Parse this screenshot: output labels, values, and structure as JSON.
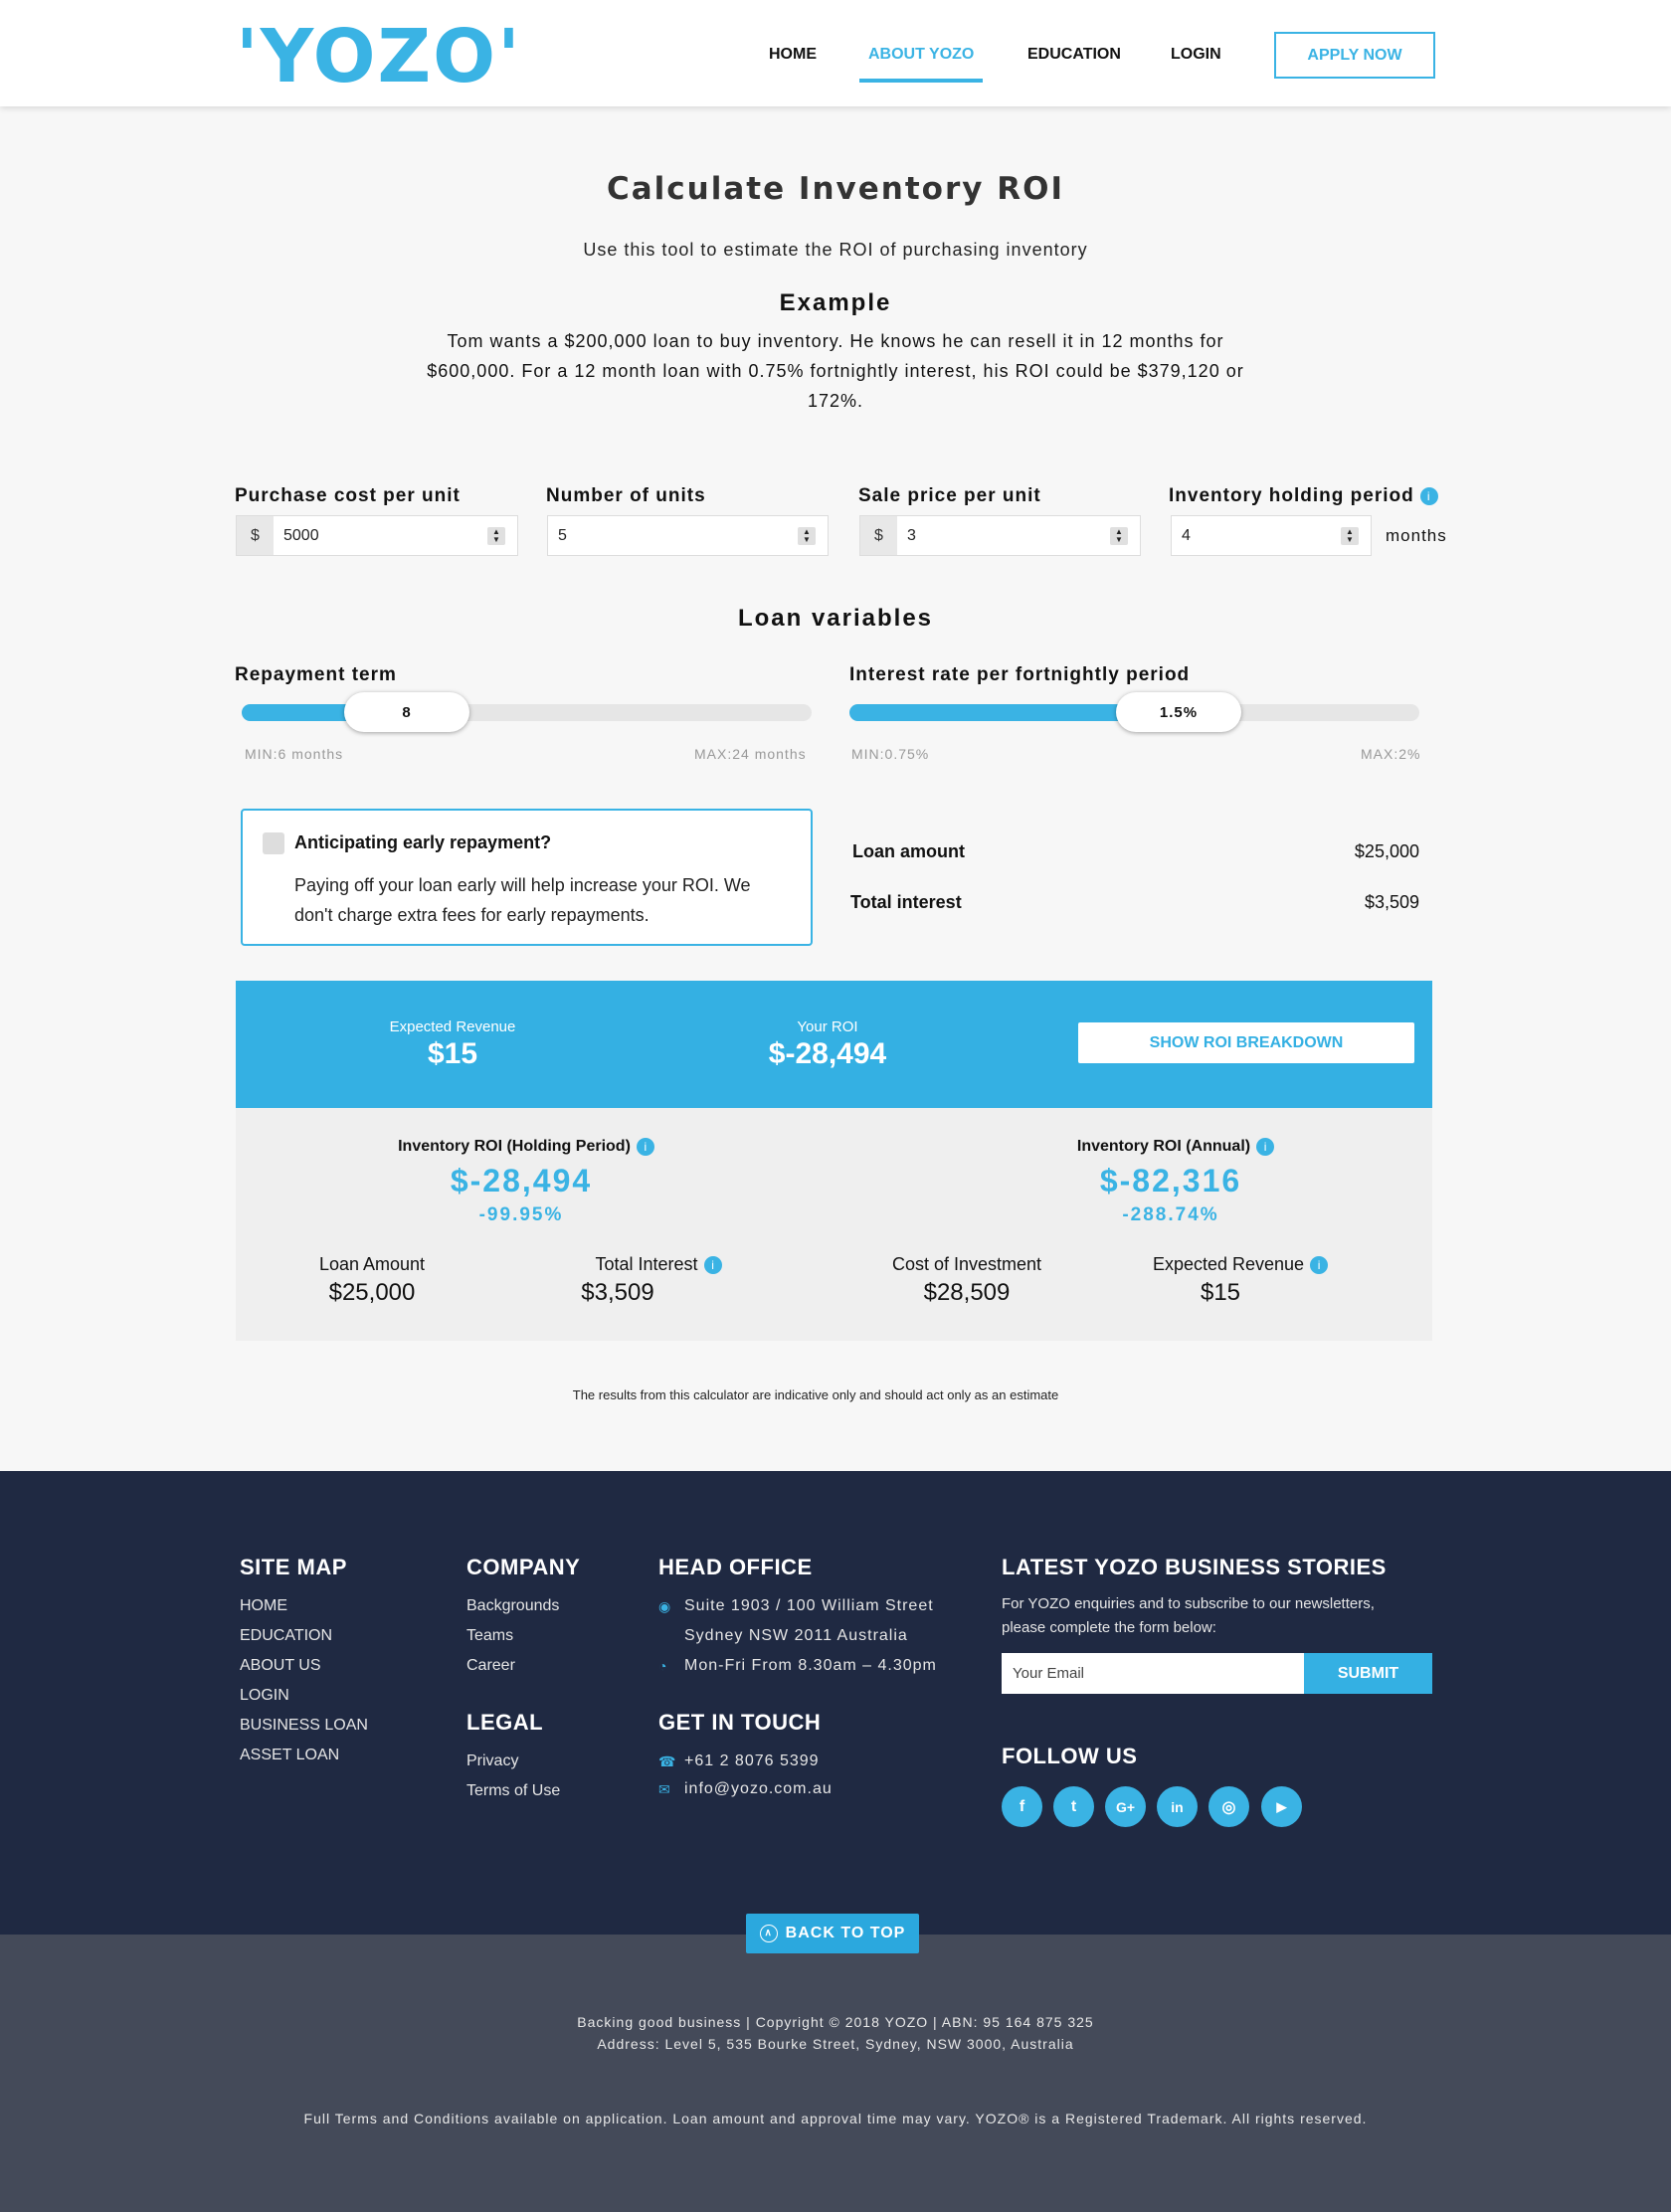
{
  "header": {
    "logo": "'YOZO'",
    "nav": [
      "HOME",
      "ABOUT YOZO",
      "EDUCATION",
      "LOGIN"
    ],
    "active_nav": "ABOUT YOZO",
    "apply": "APPLY NOW"
  },
  "intro": {
    "title": "Calculate Inventory ROI",
    "subtitle": "Use this  tool to estimate the ROI of purchasing inventory",
    "example_heading": "Example",
    "example_text": "Tom wants a $200,000 loan to buy inventory. He knows he can resell it in 12 months for $600,000. For a 12 month loan with 0.75% fortnightly interest, his ROI could be $379,120 or 172%."
  },
  "inputs": {
    "purchase_cost": {
      "label": "Purchase cost per unit",
      "prefix": "$",
      "value": "5000"
    },
    "units": {
      "label": "Number of units",
      "value": "5"
    },
    "sale_price": {
      "label": "Sale price per unit",
      "prefix": "$",
      "value": "3"
    },
    "holding": {
      "label": "Inventory holding period",
      "value": "4",
      "suffix": "months",
      "info": "i"
    }
  },
  "loan": {
    "heading": "Loan variables",
    "repayment": {
      "label": "Repayment term",
      "value": "8",
      "min_label": "MIN:6 months",
      "max_label": "MAX:24 months",
      "min": 6,
      "max": 24,
      "current": 8
    },
    "interest": {
      "label": "Interest rate per fortnightly period",
      "value": "1.5%",
      "min_label": "MIN:0.75%",
      "max_label": "MAX:2%",
      "min": 0.75,
      "max": 2,
      "current": 1.5
    }
  },
  "early": {
    "title": "Anticipating  early  repayment?",
    "text": "Paying off your loan early will help increase your ROI. We don't charge extra fees for early repayments."
  },
  "summary": {
    "loan_amount_label": "Loan amount",
    "loan_amount": "$25,000",
    "total_interest_label": "Total interest",
    "total_interest": "$3,509"
  },
  "banner": {
    "revenue_label": "Expected Revenue",
    "revenue": "$15",
    "roi_label": "Your ROI",
    "roi": "$-28,494",
    "button": "SHOW ROI BREAKDOWN"
  },
  "details": {
    "holding_label": "Inventory ROI (Holding Period)",
    "holding_value": "$-28,494",
    "holding_pct": "-99.95%",
    "annual_label": "Inventory ROI (Annual)",
    "annual_value": "$-82,316",
    "annual_pct": "-288.74%",
    "loan_amount_label": "Loan Amount",
    "loan_amount": "$25,000",
    "interest_label": "Total Interest",
    "interest": "$3,509",
    "cost_label": "Cost of Investment",
    "cost": "$28,509",
    "revenue_label": "Expected Revenue",
    "revenue": "$15"
  },
  "disclaimer": "The results from this calculator are indicative only and should act only as an estimate",
  "footer": {
    "sitemap_h": "SITE MAP",
    "sitemap": [
      "HOME",
      "EDUCATION",
      "ABOUT US",
      "LOGIN",
      "BUSINESS LOAN",
      "ASSET LOAN"
    ],
    "company_h": "COMPANY",
    "company": [
      "Backgrounds",
      "Teams",
      "Career"
    ],
    "legal_h": "LEGAL",
    "legal": [
      "Privacy",
      "Terms of Use"
    ],
    "office_h": "HEAD OFFICE",
    "address1": "Suite 1903 / 100 William Street",
    "address2": "Sydney NSW 2011 Australia",
    "hours": "Mon-Fri From 8.30am – 4.30pm",
    "touch_h": "GET IN TOUCH",
    "phone": "+61 2 8076 5399",
    "email": "info@yozo.com.au",
    "stories_h": "LATEST YOZO BUSINESS STORIES",
    "news_text": "For YOZO enquiries and to subscribe to our newsletters, please complete the form below:",
    "email_placeholder": "Your Email",
    "submit": "SUBMIT",
    "follow_h": "FOLLOW US",
    "social": [
      {
        "name": "facebook-icon",
        "glyph": "f"
      },
      {
        "name": "twitter-icon",
        "glyph": "t"
      },
      {
        "name": "google-plus-icon",
        "glyph": "G+"
      },
      {
        "name": "linkedin-icon",
        "glyph": "in"
      },
      {
        "name": "instagram-icon",
        "glyph": "◎"
      },
      {
        "name": "youtube-icon",
        "glyph": "▶"
      }
    ]
  },
  "bottom": {
    "back_to_top": "BACK TO TOP",
    "copyright": "Backing good business | Copyright © 2018 YOZO | ABN: 95 164 875 325",
    "address": "Address: Level 5, 535 Bourke Street, Sydney, NSW 3000, Australia",
    "terms": "Full Terms and Conditions available on application. Loan amount and approval time may vary. YOZO® is a Registered Trademark. All rights reserved."
  },
  "colors": {
    "accent": "#3ab3e4",
    "footer": "#1f2942",
    "bottom": "#444a59"
  }
}
